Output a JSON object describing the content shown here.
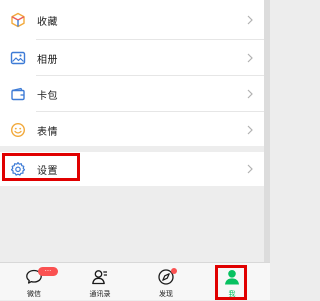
{
  "menu": {
    "group1": [
      {
        "label": "收藏",
        "icon": "favorites-cube-icon"
      },
      {
        "label": "相册",
        "icon": "album-picture-icon"
      },
      {
        "label": "卡包",
        "icon": "card-wallet-icon"
      },
      {
        "label": "表情",
        "icon": "emoji-smile-icon"
      }
    ],
    "group2": [
      {
        "label": "设置",
        "icon": "settings-gear-icon"
      }
    ]
  },
  "tabbar": {
    "tabs": [
      {
        "label": "微信",
        "icon": "chat-bubble-icon",
        "badge": "···"
      },
      {
        "label": "通讯录",
        "icon": "contacts-icon"
      },
      {
        "label": "发现",
        "icon": "compass-icon"
      },
      {
        "label": "我",
        "icon": "person-icon",
        "active": true
      }
    ]
  },
  "colors": {
    "accent_green": "#07c160",
    "badge_red": "#fa5151",
    "highlight_red": "#e00000",
    "settings_blue": "#3d7bd6"
  }
}
